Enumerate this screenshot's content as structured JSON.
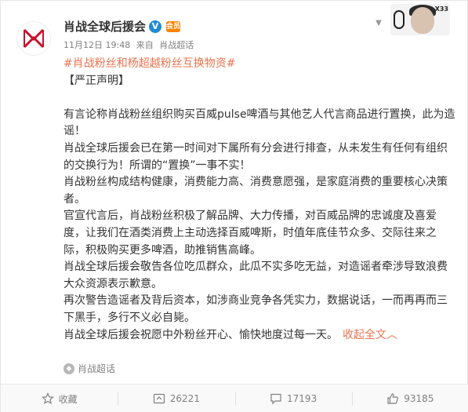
{
  "post": {
    "author": "肖战全球后援会",
    "verified_badge": "V",
    "member_badge": "会员",
    "date": "11月12日 19:48",
    "via_prefix": "来自",
    "via": "肖战超话",
    "hashtag": "#肖战粉丝和杨超越粉丝互换物资#",
    "paragraphs": [
      "【严正声明】",
      "",
      "有言论称肖战粉丝组织购买百威pulse啤酒与其他艺人代言商品进行置换，此为造谣！",
      "肖战全球后援会已在第一时间对下属所有分会进行排查，从未发生有任何有组织的交换行为！所谓的“置换”一事不实！",
      "肖战粉丝构成结构健康，消费能力高、消费意愿强，是家庭消费的重要核心决策者。",
      "官宣代言后，肖战粉丝积极了解品牌、大力传播，对百威品牌的忠诚度及喜爱度，让我们在酒类消费上主动选择百威啤斯，时值年底佳节众多、交际往来之际，积极购买更多啤酒，助推销售高峰。",
      "肖战全球后援会敬告各位吃瓜群众，此瓜不实多吃无益，对造谣者牵涉导致浪费大众资源表示歉意。",
      "再次警告造谣者及背后资本，如涉商业竞争各凭实力，数据说话，一而再再而三下黑手，多行不义必自毙。"
    ],
    "last_paragraph": "肖战全球后援会祝愿中外粉丝开心、愉快地度过每一天。",
    "fold_label": "收起全文",
    "fold_arrow": "︿",
    "source_label": "肖战超话"
  },
  "footer": {
    "favorite_label": "收藏",
    "repost_count": "26221",
    "comment_count": "17193",
    "like_count": "93185"
  },
  "corner_tag": "X33",
  "colors": {
    "link": "#eb7350",
    "verified": "#1f8bd8",
    "member": "#ff8200",
    "text": "#333333",
    "muted": "#808080"
  }
}
